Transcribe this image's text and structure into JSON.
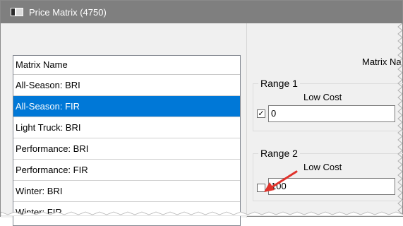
{
  "window": {
    "title": "Price Matrix (4750)"
  },
  "list": {
    "header": "Matrix Name",
    "rows": [
      {
        "label": "All-Season: BRI",
        "selected": false
      },
      {
        "label": "All-Season: FIR",
        "selected": true
      },
      {
        "label": "Light Truck: BRI",
        "selected": false
      },
      {
        "label": "Performance: BRI",
        "selected": false
      },
      {
        "label": "Performance: FIR",
        "selected": false
      },
      {
        "label": "Winter: BRI",
        "selected": false
      },
      {
        "label": "Winter: FIR",
        "selected": false
      }
    ]
  },
  "right": {
    "matrix_name_label": "Matrix Na",
    "range1": {
      "title": "Range 1",
      "low_cost_label": "Low Cost",
      "checked": true,
      "checkmark": "✓",
      "value": "0"
    },
    "range2": {
      "title": "Range 2",
      "low_cost_label": "Low Cost",
      "checked": false,
      "checkmark": "",
      "value": "100"
    }
  },
  "colors": {
    "selection": "#0078d7",
    "arrow": "#e0322b",
    "titlebar": "#7f7f7f"
  },
  "icons": {
    "app": "price-matrix-app-icon",
    "annotation": "red-arrow-annotation"
  }
}
